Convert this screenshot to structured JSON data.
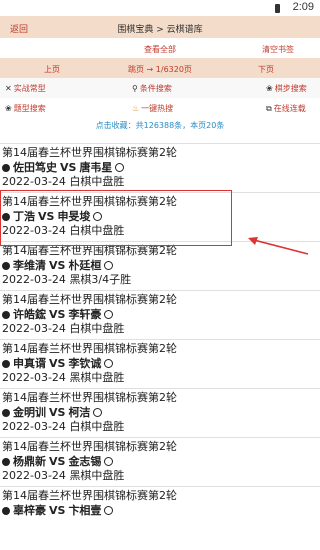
{
  "status_bar": {
    "time": "2:09"
  },
  "topbar": {
    "back_label": "返回",
    "title": "围棋宝典 > 云棋谱库"
  },
  "actions": {
    "view_favorites": "查看全部",
    "clear_bookmarks": "清空书签"
  },
  "pager": {
    "prev": "上页",
    "jump": "跳页 → 1/6320页",
    "next": "下页"
  },
  "tools": [
    {
      "label": "实战常型",
      "icon": "crossed-swords-icon"
    },
    {
      "label": "条件搜索",
      "icon": "search-icon"
    },
    {
      "label": "棋步搜索",
      "icon": "paw-icon"
    }
  ],
  "tools2": [
    {
      "label": "题型搜索",
      "icon": "paw-icon"
    },
    {
      "label": "一键热搜",
      "icon": "flame-icon"
    },
    {
      "label": "在线连载",
      "icon": "external-link-icon"
    }
  ],
  "stats": "点击收藏：共126388条，本页20条",
  "games": [
    {
      "event": "第14届春兰杯世界围棋锦标赛第2轮",
      "black": "佐田笃史",
      "white": "唐韦星",
      "date": "2022-03-24",
      "result": "白棋中盘胜"
    },
    {
      "event": "第14届春兰杯世界围棋锦标赛第2轮",
      "black": "丁浩",
      "white": "申旻埈",
      "date": "2022-03-24",
      "result": "白棋中盘胜"
    },
    {
      "event": "第14届春兰杯世界围棋锦标赛第2轮",
      "black": "李维清",
      "white": "朴廷桓",
      "date": "2022-03-24",
      "result": "黑棋3/4子胜"
    },
    {
      "event": "第14届春兰杯世界围棋锦标赛第2轮",
      "black": "许皓鋐",
      "white": "李轩豪",
      "date": "2022-03-24",
      "result": "白棋中盘胜"
    },
    {
      "event": "第14届春兰杯世界围棋锦标赛第2轮",
      "black": "申真谞",
      "white": "李钦诚",
      "date": "2022-03-24",
      "result": "黑棋中盘胜"
    },
    {
      "event": "第14届春兰杯世界围棋锦标赛第2轮",
      "black": "金明训",
      "white": "柯洁",
      "date": "2022-03-24",
      "result": "白棋中盘胜"
    },
    {
      "event": "第14届春兰杯世界围棋锦标赛第2轮",
      "black": "杨鼎新",
      "white": "金志锡",
      "date": "2022-03-24",
      "result": "黑棋中盘胜"
    },
    {
      "event": "第14届春兰杯世界围棋锦标赛第2轮",
      "black": "辜梓豪",
      "white": "卞相壹",
      "date": "",
      "result": ""
    }
  ]
}
